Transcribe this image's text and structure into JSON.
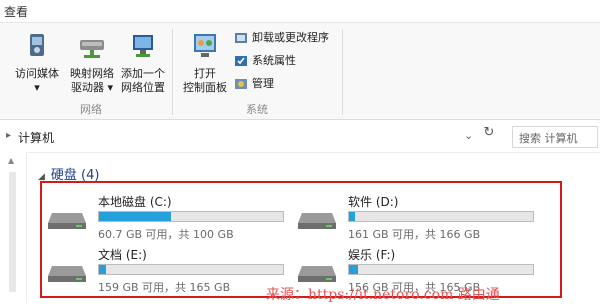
{
  "ribbon": {
    "tab_label": "查看",
    "buttons": {
      "media": {
        "label1": "访问媒体",
        "label2": "▾"
      },
      "map_drive": {
        "label1": "映射网络",
        "label2": "驱动器 ▾"
      },
      "net_loc": {
        "label1": "添加一个",
        "label2": "网络位置"
      },
      "control_panel": {
        "label1": "打开",
        "label2": "控制面板"
      }
    },
    "group_network": "网络",
    "group_system": "系统",
    "small_items": [
      "卸载或更改程序",
      "系统属性",
      "管理"
    ]
  },
  "address": {
    "path": "计算机",
    "search_placeholder": "搜索 计算机"
  },
  "section": {
    "title": "硬盘 (4)"
  },
  "drives": [
    {
      "name": "本地磁盘 (C:)",
      "info": "60.7 GB 可用，共 100 GB",
      "used_fraction": 0.39
    },
    {
      "name": "软件 (D:)",
      "info": "161 GB 可用，共 166 GB",
      "used_fraction": 0.03
    },
    {
      "name": "文档 (E:)",
      "info": "159 GB 可用，共 165 GB",
      "used_fraction": 0.04
    },
    {
      "name": "娱乐 (F:)",
      "info": "156 GB 可用，共 165 GB",
      "used_fraction": 0.05
    }
  ],
  "watermark": "来源：https://it.netoro.com 路由通",
  "colors": {
    "accent_bar": "#26a0da",
    "highlight_border": "#d41a1a",
    "section_title": "#1e3f8c"
  }
}
